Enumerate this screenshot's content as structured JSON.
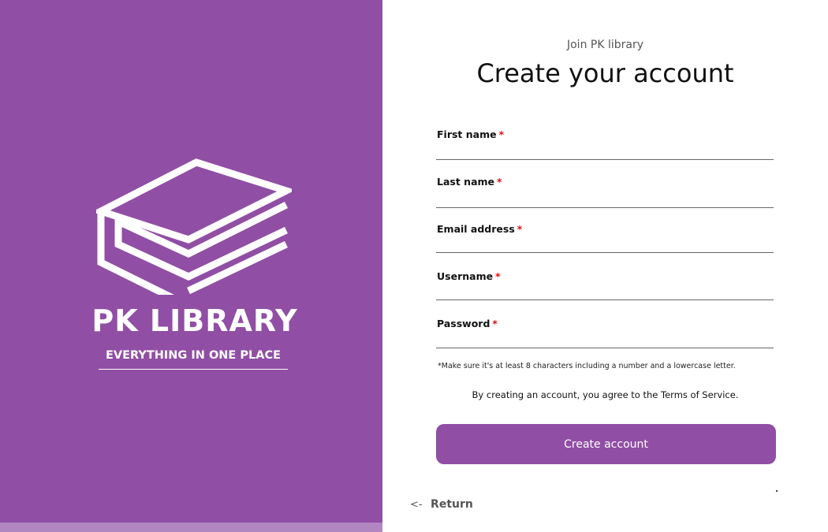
{
  "brand": {
    "name": "PK LIBRARY",
    "tagline": "EVERYTHING IN ONE PLACE",
    "logo_icon": "book-stack-icon",
    "accent_color": "#914ea5"
  },
  "header": {
    "subtitle": "Join PK library",
    "title": "Create your account"
  },
  "form": {
    "fields": [
      {
        "label": "First name",
        "required_mark": "*",
        "value": ""
      },
      {
        "label": "Last name",
        "required_mark": "*",
        "value": ""
      },
      {
        "label": "Email address",
        "required_mark": "*",
        "value": ""
      },
      {
        "label": "Username",
        "required_mark": "*",
        "value": ""
      },
      {
        "label": "Password",
        "required_mark": "*",
        "value": ""
      }
    ],
    "password_hint": "*Make sure it's at least 8 characters including a number and a lowercase letter.",
    "terms_text": "By creating an account, you agree to the Terms of Service.",
    "submit_label": "Create account"
  },
  "footer": {
    "return_arrow": "<-",
    "return_label": "Return"
  }
}
